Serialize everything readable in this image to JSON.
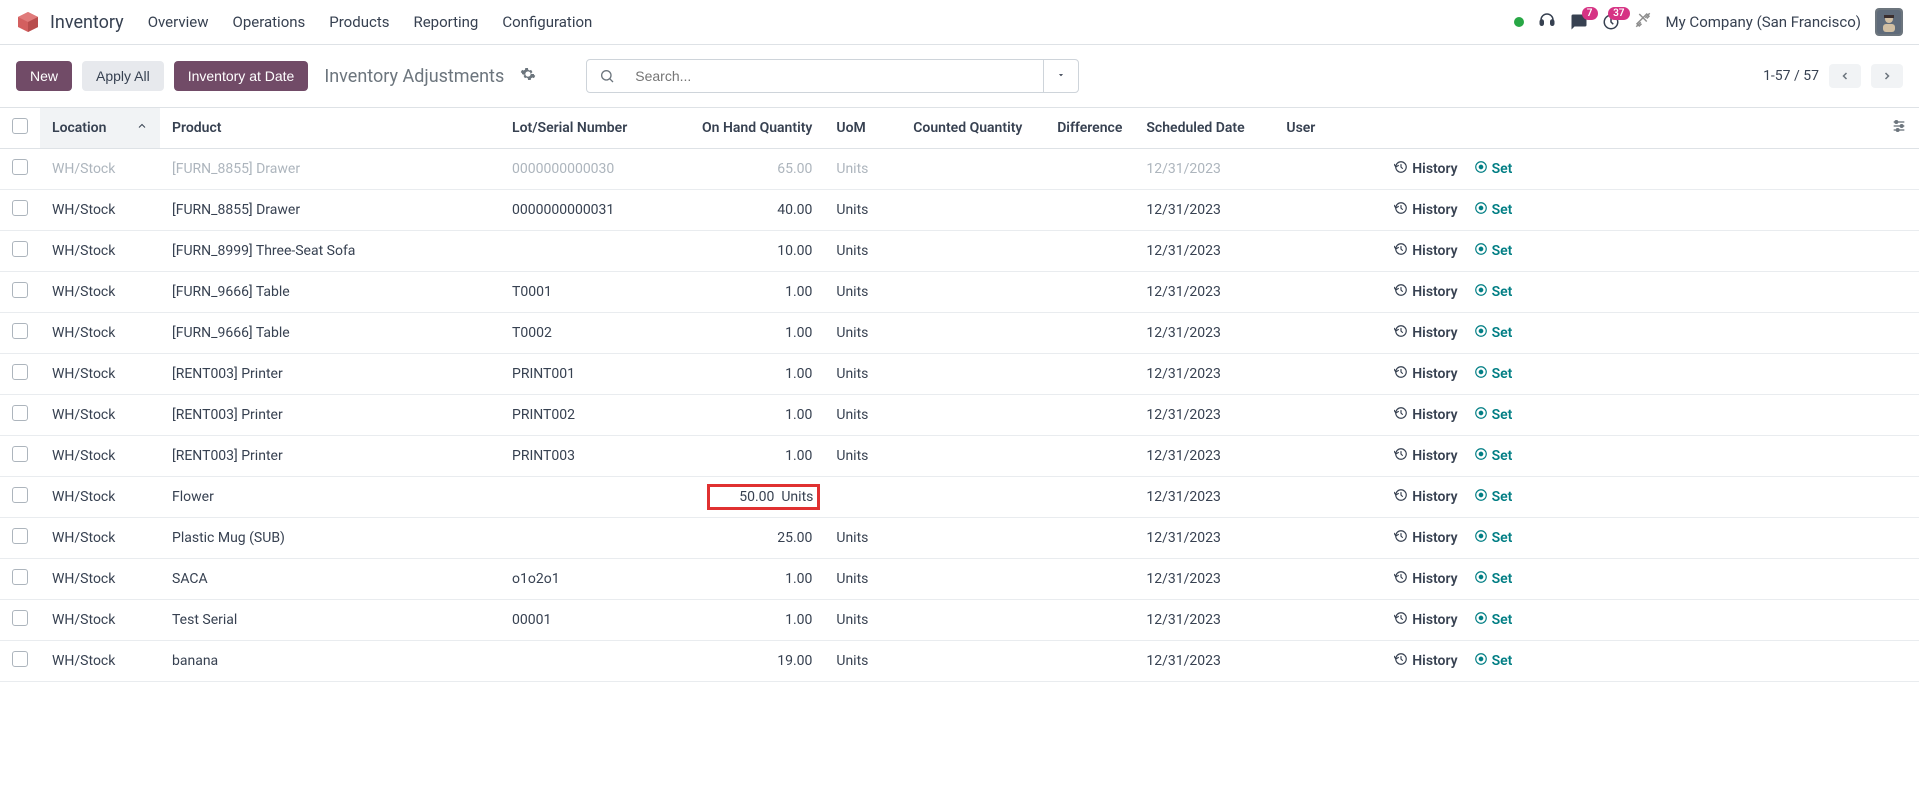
{
  "app": {
    "name": "Inventory"
  },
  "topnav": [
    "Overview",
    "Operations",
    "Products",
    "Reporting",
    "Configuration"
  ],
  "topbar": {
    "company": "My Company (San Francisco)",
    "messagesBadge": "7",
    "activitiesBadge": "37"
  },
  "action": {
    "new": "New",
    "applyAll": "Apply All",
    "inventoryAtDate": "Inventory at Date",
    "breadcrumb": "Inventory Adjustments",
    "searchPlaceholder": "Search...",
    "pager": "1-57 / 57"
  },
  "columns": {
    "location": "Location",
    "product": "Product",
    "lot": "Lot/Serial Number",
    "onhand": "On Hand Quantity",
    "uom": "UoM",
    "counted": "Counted Quantity",
    "diff": "Difference",
    "date": "Scheduled Date",
    "user": "User"
  },
  "rowActions": {
    "history": "History",
    "set": "Set"
  },
  "rows": [
    {
      "location": "WH/Stock",
      "product": "[FURN_8855] Drawer",
      "lot": "0000000000030",
      "onhand": "65.00",
      "uom": "Units",
      "date": "12/31/2023",
      "cut": true
    },
    {
      "location": "WH/Stock",
      "product": "[FURN_8855] Drawer",
      "lot": "0000000000031",
      "onhand": "40.00",
      "uom": "Units",
      "date": "12/31/2023"
    },
    {
      "location": "WH/Stock",
      "product": "[FURN_8999] Three-Seat Sofa",
      "lot": "",
      "onhand": "10.00",
      "uom": "Units",
      "date": "12/31/2023"
    },
    {
      "location": "WH/Stock",
      "product": "[FURN_9666] Table",
      "lot": "T0001",
      "onhand": "1.00",
      "uom": "Units",
      "date": "12/31/2023"
    },
    {
      "location": "WH/Stock",
      "product": "[FURN_9666] Table",
      "lot": "T0002",
      "onhand": "1.00",
      "uom": "Units",
      "date": "12/31/2023"
    },
    {
      "location": "WH/Stock",
      "product": "[RENT003] Printer",
      "lot": "PRINT001",
      "onhand": "1.00",
      "uom": "Units",
      "date": "12/31/2023"
    },
    {
      "location": "WH/Stock",
      "product": "[RENT003] Printer",
      "lot": "PRINT002",
      "onhand": "1.00",
      "uom": "Units",
      "date": "12/31/2023"
    },
    {
      "location": "WH/Stock",
      "product": "[RENT003] Printer",
      "lot": "PRINT003",
      "onhand": "1.00",
      "uom": "Units",
      "date": "12/31/2023"
    },
    {
      "location": "WH/Stock",
      "product": "Flower",
      "lot": "",
      "onhand": "50.00",
      "uom": "Units",
      "date": "12/31/2023",
      "highlight": true
    },
    {
      "location": "WH/Stock",
      "product": "Plastic Mug (SUB)",
      "lot": "",
      "onhand": "25.00",
      "uom": "Units",
      "date": "12/31/2023"
    },
    {
      "location": "WH/Stock",
      "product": "SACA",
      "lot": "o1o2o1",
      "onhand": "1.00",
      "uom": "Units",
      "date": "12/31/2023"
    },
    {
      "location": "WH/Stock",
      "product": "Test Serial",
      "lot": "00001",
      "onhand": "1.00",
      "uom": "Units",
      "date": "12/31/2023"
    },
    {
      "location": "WH/Stock",
      "product": "banana",
      "lot": "",
      "onhand": "19.00",
      "uom": "Units",
      "date": "12/31/2023"
    }
  ]
}
